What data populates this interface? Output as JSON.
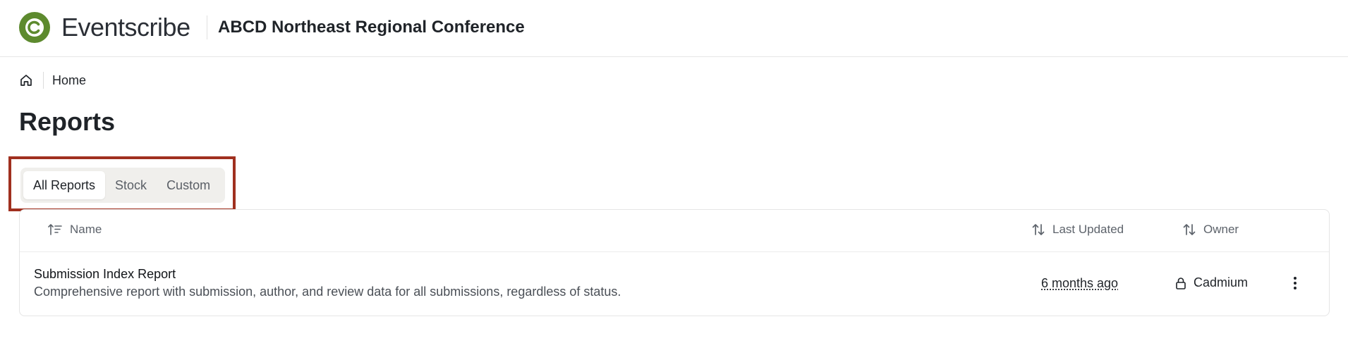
{
  "header": {
    "brand": "Eventscribe",
    "conference_title": "ABCD Northeast Regional Conference",
    "logo_letter": "C",
    "logo_color": "#5d8a2e"
  },
  "breadcrumb": {
    "home_label": "Home"
  },
  "page": {
    "title": "Reports"
  },
  "tabs": [
    {
      "label": "All Reports",
      "active": true
    },
    {
      "label": "Stock",
      "active": false
    },
    {
      "label": "Custom",
      "active": false
    }
  ],
  "table": {
    "columns": {
      "name": "Name",
      "last_updated": "Last Updated",
      "owner": "Owner"
    },
    "rows": [
      {
        "name": "Submission Index Report",
        "description": "Comprehensive report with submission, author, and review data for all submissions, regardless of status.",
        "last_updated": "6 months ago",
        "owner": "Cadmium"
      }
    ]
  },
  "colors": {
    "highlight_border": "#a0301f",
    "tab_background": "#f0efec"
  }
}
